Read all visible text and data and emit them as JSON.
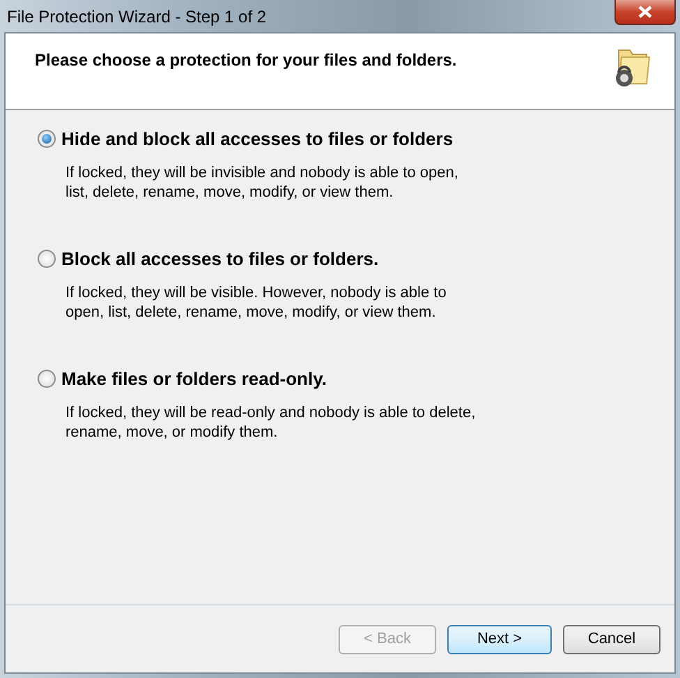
{
  "window": {
    "title": "File Protection Wizard - Step 1 of 2"
  },
  "header": {
    "text": "Please choose a protection for your files and folders."
  },
  "options": [
    {
      "label": "Hide and block all accesses to files or folders",
      "description": "If locked, they will be invisible and nobody is able to open, list, delete, rename, move, modify, or view them.",
      "selected": true
    },
    {
      "label": "Block all accesses to files or folders.",
      "description": "If locked, they will be visible. However, nobody is able to open, list, delete, rename, move, modify, or view them.",
      "selected": false
    },
    {
      "label": "Make files or folders read-only.",
      "description": "If locked, they will be read-only and nobody is able to delete, rename, move, or modify them.",
      "selected": false
    }
  ],
  "buttons": [
    {
      "label": "< Back",
      "disabled": true,
      "default": false
    },
    {
      "label": "Next >",
      "disabled": false,
      "default": true
    },
    {
      "label": "Cancel",
      "disabled": false,
      "default": false
    }
  ]
}
